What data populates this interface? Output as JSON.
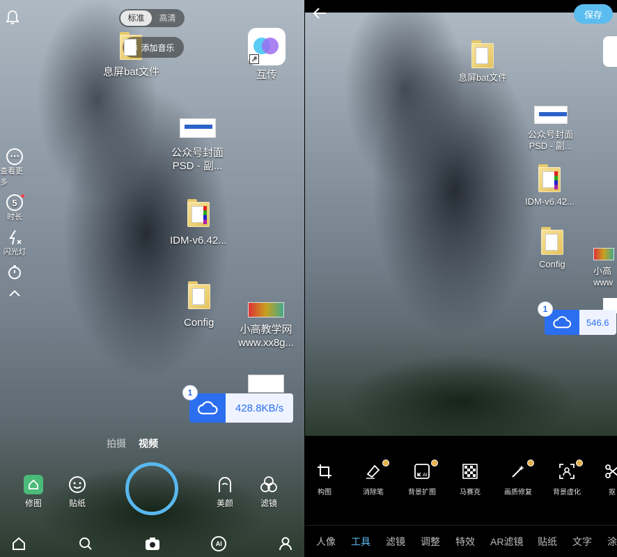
{
  "left": {
    "quality": {
      "standard": "标准",
      "hd": "高清"
    },
    "music_label": "添加音乐",
    "desktop_icons": {
      "bat": "息屏bat文件",
      "hutrans": "互传",
      "psd_line1": "公众号封面",
      "psd_line2": "PSD - 副...",
      "idm": "IDM-v6.42...",
      "config": "Config",
      "xiaogao_line1": "小高教学网",
      "xiaogao_line2": "www.xx8g..."
    },
    "upload": {
      "count": "1",
      "speed": "428.8KB/s"
    },
    "side_tools": {
      "more": "查看更多",
      "duration_value": "5",
      "duration": "时长",
      "flash": "闪光灯"
    },
    "modes": {
      "photo": "拍摄",
      "video": "视频"
    },
    "actions": {
      "edit": "修图",
      "sticker": "贴纸",
      "beauty": "美颜",
      "filter": "滤镜"
    },
    "nav": {
      "ai": "AI"
    }
  },
  "right": {
    "save": "保存",
    "desktop_icons": {
      "bat": "息屏bat文件",
      "psd_line1": "公众号封面",
      "psd_line2": "PSD - 副...",
      "idm": "IDM-v6.42...",
      "config": "Config",
      "xiaogao_line1": "小高",
      "xiaogao_line2": "www"
    },
    "upload": {
      "count": "1",
      "speed": "546.6"
    },
    "tools": {
      "crop": "构图",
      "eraser": "消除笔",
      "bg_expand": "背景扩图",
      "mosaic": "马赛克",
      "quality_fix": "画质修复",
      "bg_blur": "背景虚化",
      "cutout": "抠"
    },
    "categories": {
      "portrait": "人像",
      "tools": "工具",
      "filter": "滤镜",
      "adjust": "调整",
      "effects": "特效",
      "ar_filter": "AR滤镜",
      "sticker": "贴纸",
      "text": "文字",
      "paint": "涂"
    }
  },
  "colors": {
    "accent": "#5bbcf0",
    "upload_blue": "#2b6ef0",
    "badge_gold": "#e5b04a"
  }
}
